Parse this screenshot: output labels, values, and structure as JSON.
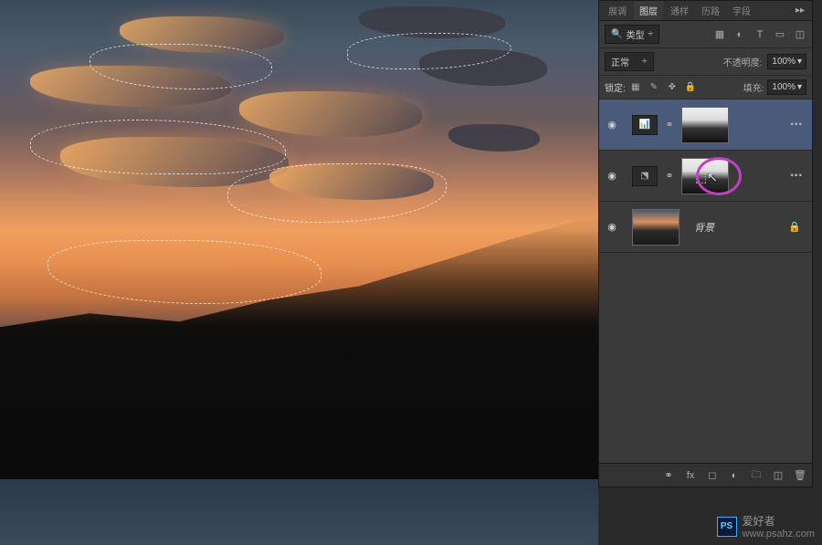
{
  "panel": {
    "tabs": [
      "展调",
      "图层",
      "通样",
      "历路",
      "字段"
    ],
    "active_tab": "图层",
    "filter_label": "类型",
    "blend_mode": "正常",
    "opacity_label": "不透明度:",
    "opacity_value": "100%",
    "lock_label": "锁定:",
    "fill_label": "填充:",
    "fill_value": "100%"
  },
  "layers": {
    "adj1_name": "",
    "adj2_name": "",
    "bg_name": "背景"
  },
  "icons": {
    "eye": "◉",
    "link": "⚭",
    "lock": "🔒",
    "menu": "▸▸",
    "dropdown": "÷",
    "tri": "▾",
    "dots": "▪▪▪"
  },
  "footer": {
    "fx": "fx"
  },
  "watermark": {
    "brand": "爱好者",
    "ps": "PS",
    "url": "www.psahz.com"
  }
}
